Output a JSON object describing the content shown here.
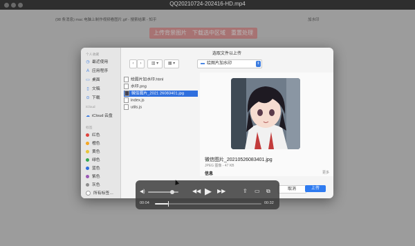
{
  "window": {
    "title": "QQ20210724-202416-HD.mp4"
  },
  "browser": {
    "tabs": [
      "(98 条消息) mac 电脑上制作视频看图片.gif - 搜索结果 - 知乎",
      "加水印"
    ]
  },
  "page": {
    "buttons": [
      "上传背景图片",
      "下载选中区域",
      "重置处理"
    ]
  },
  "dialog": {
    "title": "选取文件以上传",
    "path": "绘图片加水印",
    "sidebar": {
      "favorites_header": "个人收藏",
      "favorites": [
        {
          "icon": "clock-icon",
          "label": "最近使用"
        },
        {
          "icon": "apps-icon",
          "label": "应用程序"
        },
        {
          "icon": "desktop-icon",
          "label": "桌面"
        },
        {
          "icon": "document-icon",
          "label": "文稿"
        },
        {
          "icon": "download-icon",
          "label": "下载"
        }
      ],
      "icloud_header": "iCloud",
      "icloud": [
        {
          "icon": "cloud-icon",
          "label": "iCloud 云盘"
        }
      ],
      "tags_header": "标签",
      "tags": [
        {
          "color": "#e0443e",
          "label": "红色"
        },
        {
          "color": "#f5a623",
          "label": "橙色"
        },
        {
          "color": "#e8c53a",
          "label": "黄色"
        },
        {
          "color": "#34a853",
          "label": "绿色"
        },
        {
          "color": "#2f6fde",
          "label": "蓝色"
        },
        {
          "color": "#9b59b6",
          "label": "紫色"
        },
        {
          "color": "#8e8e8e",
          "label": "灰色"
        },
        {
          "color": "#ffffff",
          "label": "所有标签…"
        }
      ]
    },
    "files": [
      {
        "name": "绘图片加水印.html",
        "selected": false
      },
      {
        "name": "水印.png",
        "selected": false
      },
      {
        "name": "微信图片_2021 26083401.jpg",
        "selected": true
      },
      {
        "name": "index.js",
        "selected": false
      },
      {
        "name": "utils.js",
        "selected": false
      }
    ],
    "preview": {
      "name": "微信图片_20210526083401.jpg",
      "subtitle": "JPEG 图像 - 47 KB",
      "info_label": "信息",
      "more_label": "更多"
    },
    "cancel_label": "取消",
    "upload_label": "上传"
  },
  "player": {
    "current_time": "00:04",
    "total_time": "00:32",
    "progress": 0.125,
    "volume": 0.8
  }
}
